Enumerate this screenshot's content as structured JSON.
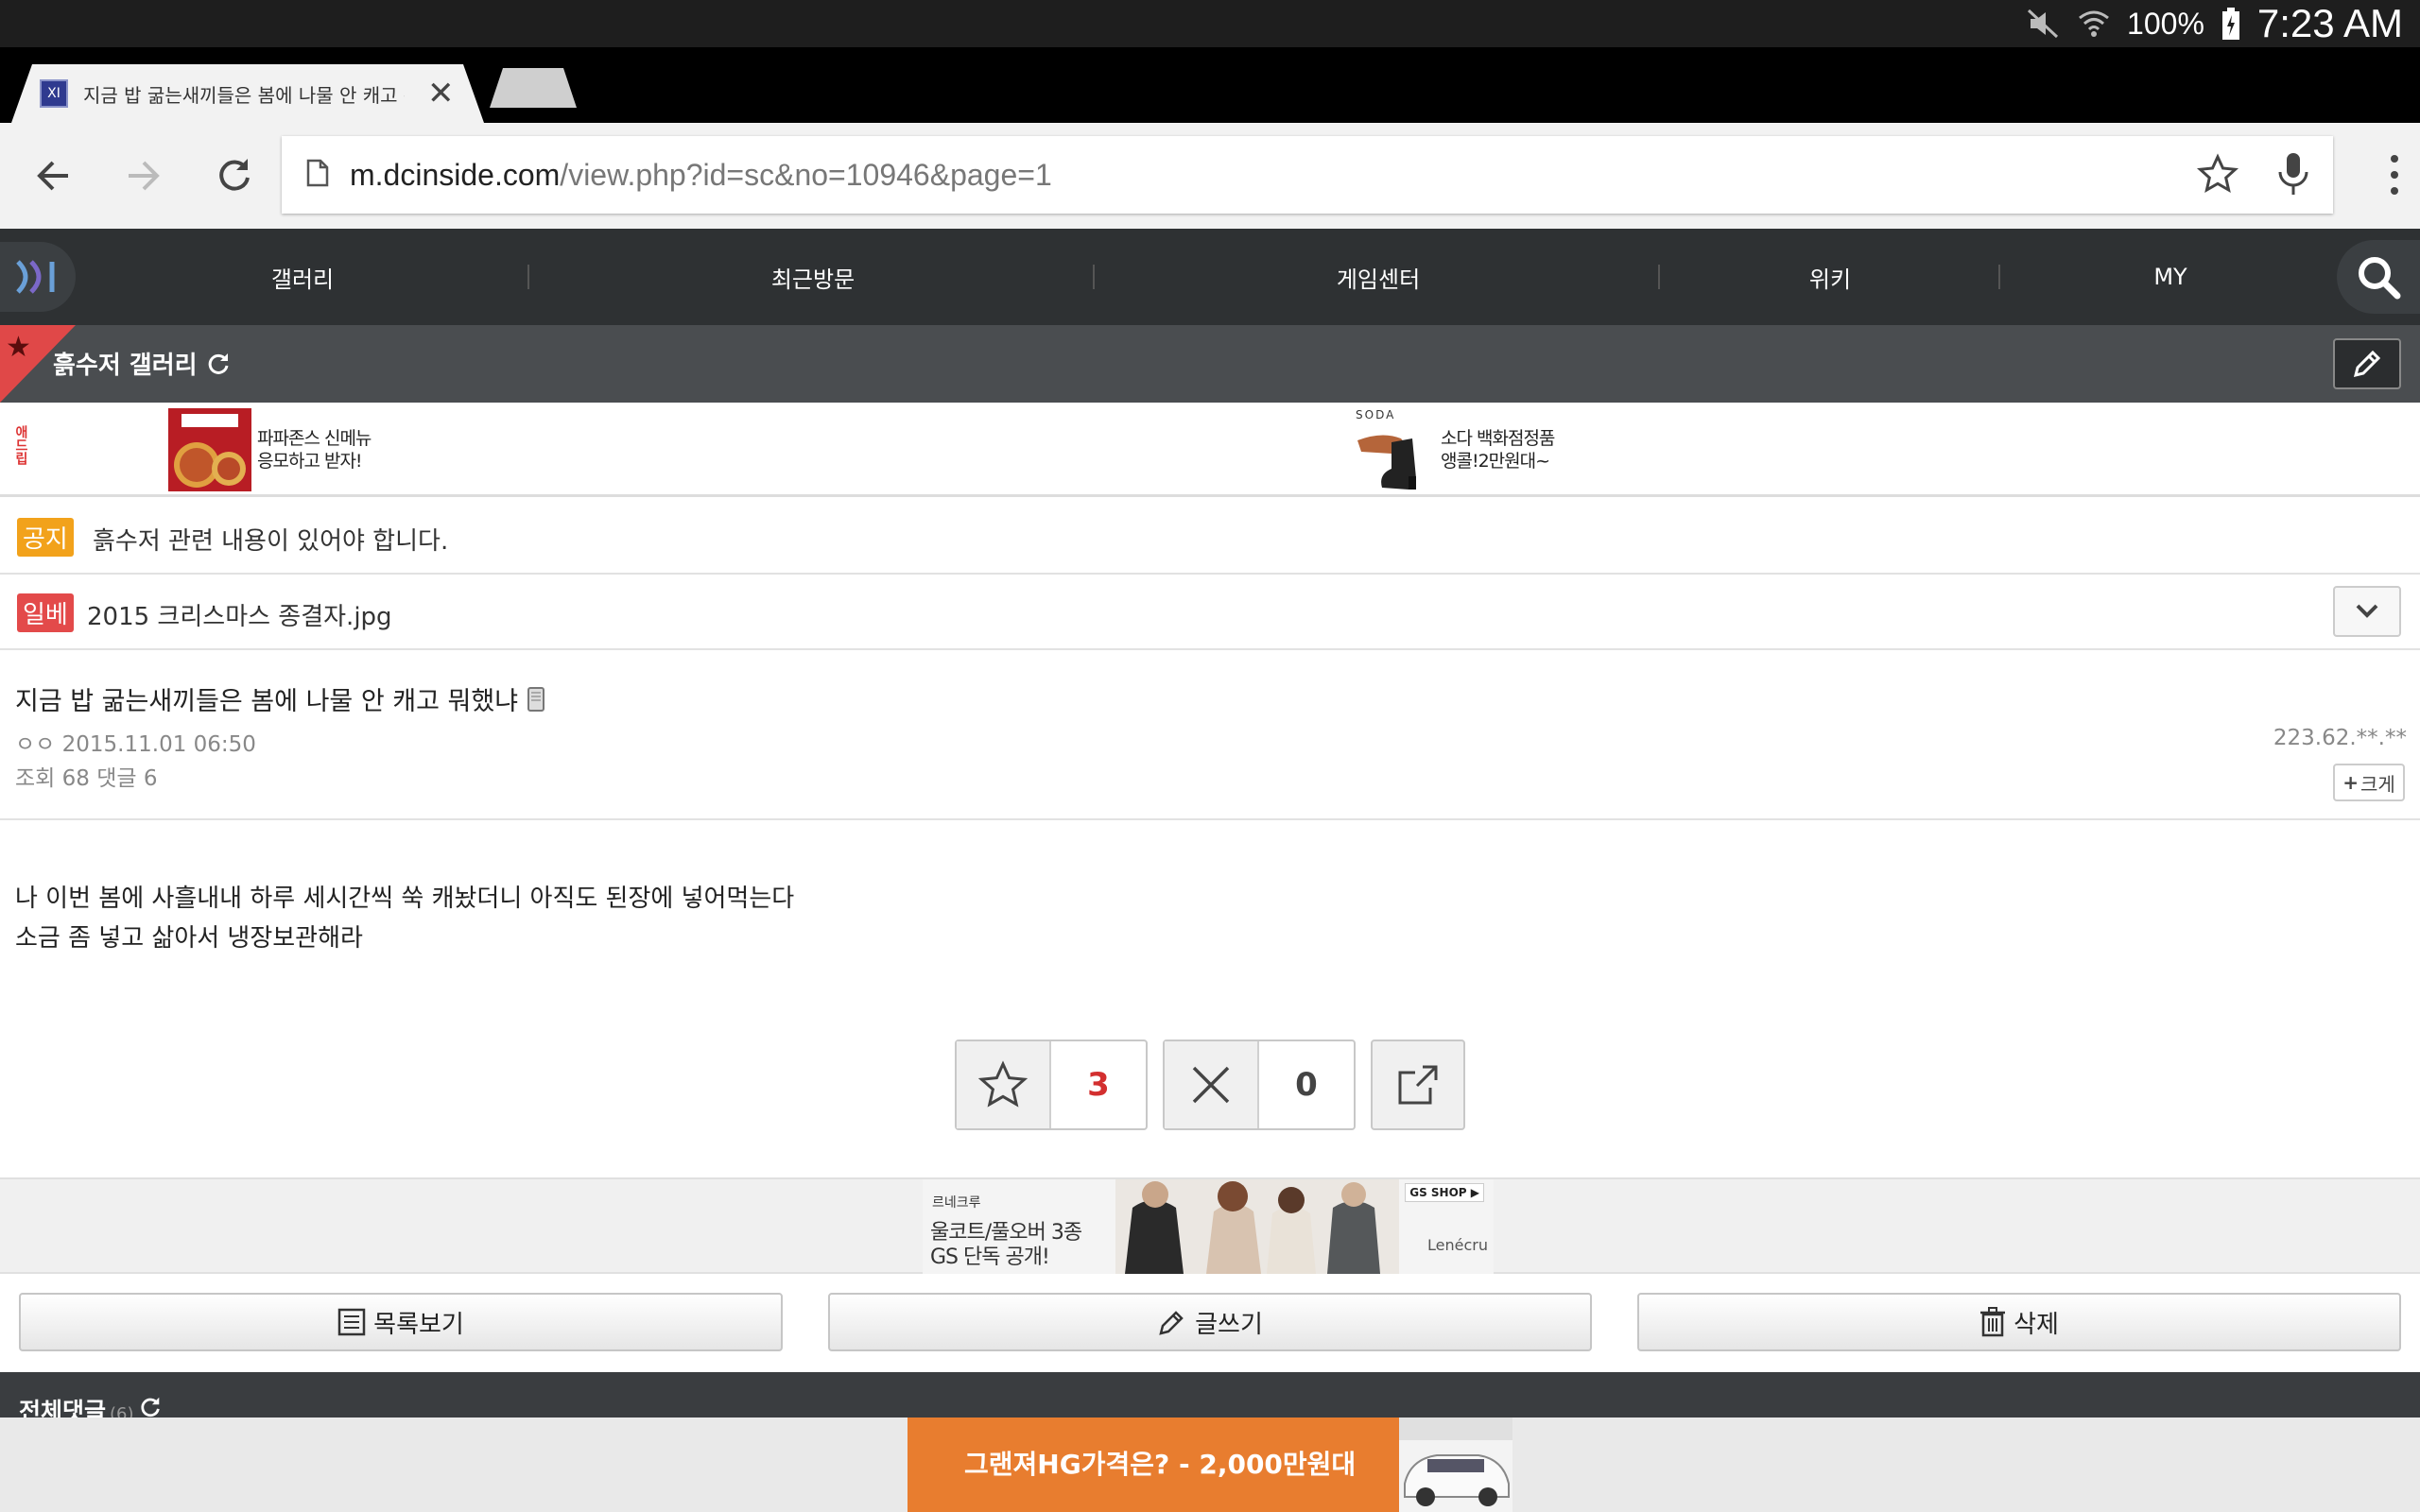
{
  "status": {
    "battery": "100%",
    "time": "7:23 AM"
  },
  "tab": {
    "title": "지금 밥 굶는새끼들은 봄에 나물 안 캐고 뭐했냐",
    "favicon": "XI"
  },
  "omnibox": {
    "domain": "m.dcinside.com",
    "path": "/view.php?id=sc&no=10946&page=1"
  },
  "nav": {
    "items": [
      "갤러리",
      "최근방문",
      "게임센터",
      "위키",
      "MY"
    ]
  },
  "gallery": {
    "title": "흙수저 갤러리"
  },
  "ads": {
    "label": "애드립",
    "left": {
      "line1": "파파존스 신메뉴",
      "line2": "응모하고 받자!"
    },
    "right_brand": "SODA",
    "right": {
      "line1": "소다 백화점정품",
      "line2": "앵콜!2만원대~"
    }
  },
  "notice": {
    "badge": "공지",
    "text": "흙수저 관련 내용이 있어야 합니다."
  },
  "ilbe": {
    "badge": "일베",
    "text": "2015 크리스마스 종결자.jpg"
  },
  "post": {
    "title": "지금 밥 굶는새끼들은 봄에 나물 안 캐고 뭐했냐",
    "author": "ㅇㅇ",
    "date": "2015.11.01 06:50",
    "views_label": "조회",
    "views": "68",
    "comments_label": "댓글",
    "comments": "6",
    "ip": "223.62.**.**",
    "size_button": "크게",
    "body": [
      "나 이번 봄에 사흘내내 하루 세시간씩 쑥 캐놨더니 아직도 된장에 넣어먹는다",
      "소금 좀 넣고 삶아서 냉장보관해라"
    ]
  },
  "votes": {
    "recommend": "3",
    "downvote": "0"
  },
  "banner": {
    "brand": "르네크루",
    "line1": "울코트/풀오버 3종",
    "line2": "GS 단독 공개!",
    "shop": "GS SHOP ▶",
    "logo": "Lenécru"
  },
  "actions": {
    "list": "목록보기",
    "write": "글쓰기",
    "delete": "삭제"
  },
  "comments_header": {
    "label": "전체댓글",
    "count": "(6)"
  },
  "bottom_ad": {
    "text": "그랜져HG가격은? - 2,000만원대"
  },
  "colors": {
    "notice_badge": "#f2a21b",
    "ilbe_badge": "#e34a4a",
    "recommend_count": "#d32f2f",
    "bottom_ad": "#e87d2f"
  }
}
